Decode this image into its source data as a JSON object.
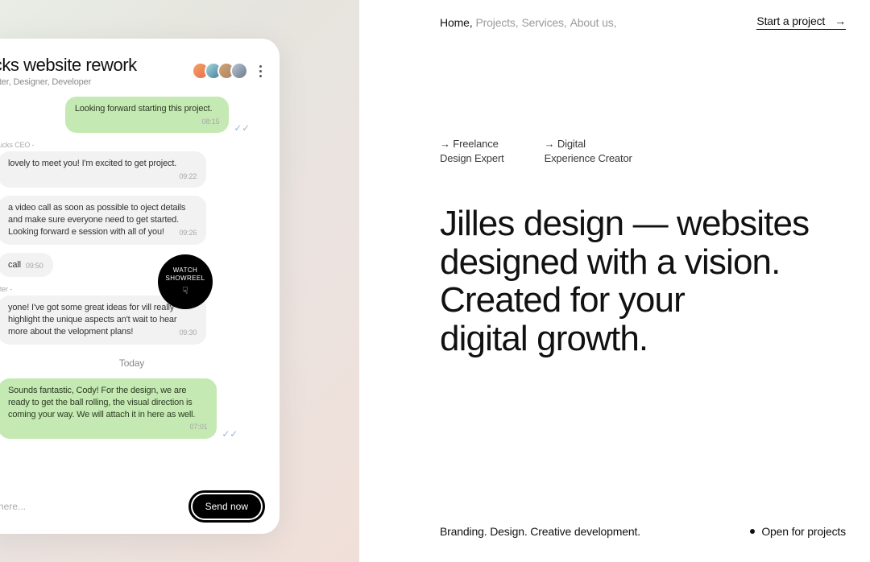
{
  "chat": {
    "title": "ucks website rework",
    "subtitle": "ywriter, Designer, Developer",
    "msg_top": "Looking forward starting this project.",
    "time_top": "08:15",
    "sender1": "ucks CEO -",
    "m1": " lovely to meet you! I'm excited to get project.",
    "t1": "09:22",
    "m2": " a video call as soon as possible to oject details and make sure everyone need to get started. Looking forward e session with all of you!",
    "t2": "09:26",
    "m3": " call",
    "t3": "09:50",
    "sender4": "iter -",
    "m4": "yone! I've got some great ideas for vill really highlight the unique aspects an't wait to hear more about the velopment plans!",
    "t4": "09:30",
    "day": "Today",
    "m5": "Sounds fantastic, Cody! For the design, we are ready to get the ball rolling, the visual direction is coming your way. We will attach it in here as well.",
    "t5": "07:01",
    "placeholder": "here...",
    "send": "Send now"
  },
  "showreel": {
    "l1": "WATCH",
    "l2": "SHOWREEL",
    "hand": "☟"
  },
  "nav": {
    "home": "Home,",
    "projects": "Projects,",
    "services": "Services,",
    "about": "About us,",
    "cta": "Start a project",
    "arrow": "→"
  },
  "tags": {
    "a1": "→ Freelance",
    "a2": "Design Expert",
    "b1": "→ Digital",
    "b2": "Experience Creator"
  },
  "headline": {
    "l1": "Jilles design — websites",
    "l2": "designed with a vision.",
    "l3": "Created for your",
    "l4": "digital growth."
  },
  "footer": {
    "left": "Branding. Design. Creative development.",
    "right": "Open for projects"
  }
}
